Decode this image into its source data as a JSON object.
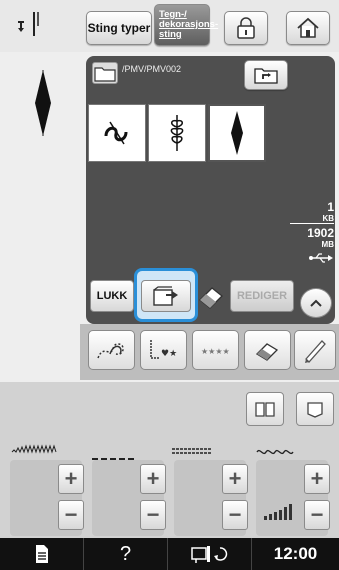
{
  "topbar": {
    "stitch_types_label": "Sting typer",
    "decor_label_lines": [
      "Tegn-/",
      "dekorasjons-",
      "sting"
    ]
  },
  "file_browser": {
    "path": "/PMV/PMV002",
    "memory": {
      "used_value": "1",
      "used_unit": "KB",
      "total_value": "1902",
      "total_unit": "MB"
    },
    "buttons": {
      "close_label": "LUKK",
      "edit_label": "REDIGER"
    }
  },
  "statusbar": {
    "help_label": "?",
    "time": "12:00"
  },
  "colors": {
    "selection_outline": "#2a8fd8",
    "panel_dark": "#4f4f4f",
    "status_bar": "#111111"
  }
}
